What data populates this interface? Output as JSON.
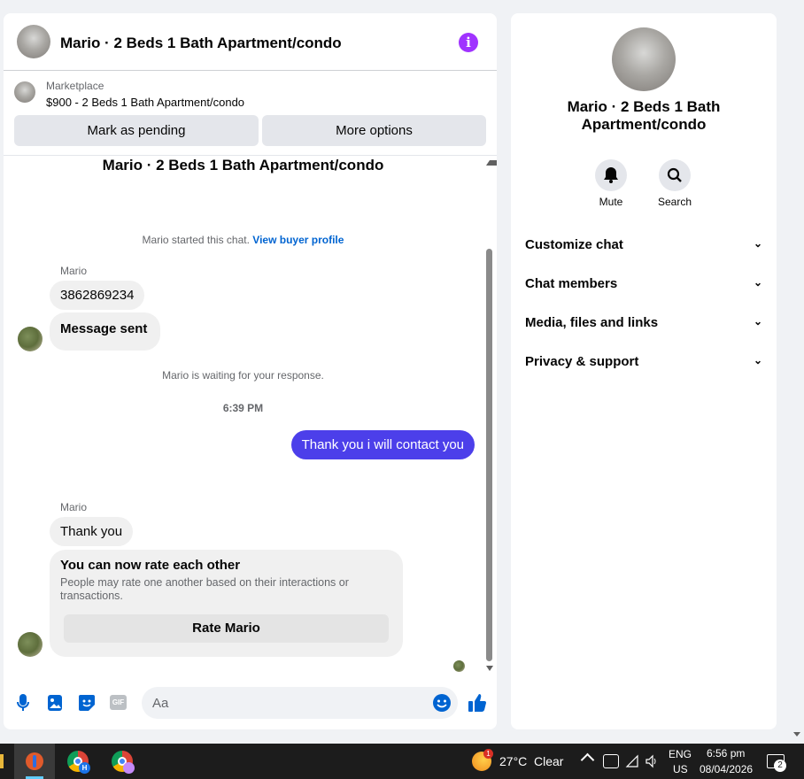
{
  "header": {
    "title": "Mario · 2 Beds 1 Bath Apartment/condo"
  },
  "listing": {
    "source": "Marketplace",
    "price_title": "$900 - 2 Beds 1 Bath Apartment/condo"
  },
  "actions": {
    "pending_label": "Mark as pending",
    "more_label": "More options"
  },
  "conversation": {
    "heading": "Mario · 2 Beds 1 Bath Apartment/condo",
    "started_text": "Mario started this chat.",
    "buyer_link": "View buyer profile",
    "sender1": "Mario",
    "msg1": "3862869234",
    "msg2": "Message sent",
    "waiting_text": "Mario is waiting for your response.",
    "timestamp": "6:39 PM",
    "outgoing": "Thank you i will contact you",
    "sender2": "Mario",
    "msg3": "Thank you",
    "rate_title": "You can now rate each other",
    "rate_desc": "People may rate one another based on their interactions or transactions.",
    "rate_button": "Rate Mario"
  },
  "composer": {
    "placeholder": "Aa",
    "gif_label": "GIF"
  },
  "sidebar": {
    "title": "Mario · 2 Beds 1 Bath Apartment/condo",
    "mute_label": "Mute",
    "search_label": "Search",
    "menu": [
      "Customize chat",
      "Chat members",
      "Media, files and links",
      "Privacy & support"
    ]
  },
  "taskbar": {
    "weather_temp": "27°C",
    "weather_cond": "Clear",
    "lang_top": "ENG",
    "lang_bottom": "US",
    "time": "6:56 pm",
    "date": "08/04/2026",
    "weather_badge": "1",
    "notif_count": "2",
    "chrome_letter": "H"
  },
  "colors": {
    "accent": "#0064d1",
    "outgoing_bubble": "#4c3fea",
    "info_icon": "#a033ff"
  }
}
